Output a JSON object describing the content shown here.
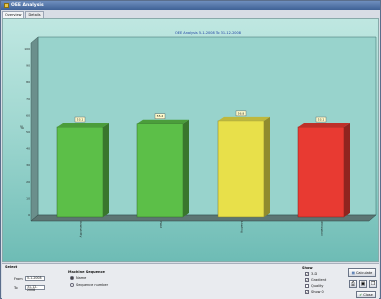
{
  "window": {
    "title": "OEE Analysis"
  },
  "tabs": [
    {
      "label": "Overview",
      "active": true
    },
    {
      "label": "Details",
      "active": false
    }
  ],
  "colors": {
    "availability": "#5cbf48",
    "yield": "#5cbf48",
    "quality": "#e8e04a",
    "oee": "#e83a32"
  },
  "chart_data": {
    "type": "bar",
    "title": "OEE Analysis 5-1-2008 To 31-12-2008",
    "categories": [
      "Availability",
      "Yield",
      "Loading",
      "Utilization"
    ],
    "series": [
      {
        "values": [
          53,
          55,
          56.7,
          53
        ]
      }
    ],
    "data_labels": [
      "53.1",
      "55.2",
      "56.8",
      "53.1"
    ],
    "ylabel": "%",
    "ylim": [
      0,
      100
    ],
    "yticks": [
      0,
      10,
      20,
      30,
      40,
      50,
      60,
      70,
      80,
      90,
      100
    ],
    "grid": false,
    "legend": "none"
  },
  "bottom": {
    "select_label": "Select",
    "from_label": "From",
    "from_value": "5-1-2008",
    "to_label": "To",
    "to_value": "31-12-2008",
    "sequence_title": "Machine Sequence",
    "seq_name": "Name",
    "seq_number": "Sequence number",
    "show_title": "Show",
    "show_3d": "3-D",
    "show_gradient": "Gradient",
    "show_quality": "Quality",
    "show_ozone": "Show 0",
    "calculate_label": "Calculate",
    "close_label": "Close"
  }
}
